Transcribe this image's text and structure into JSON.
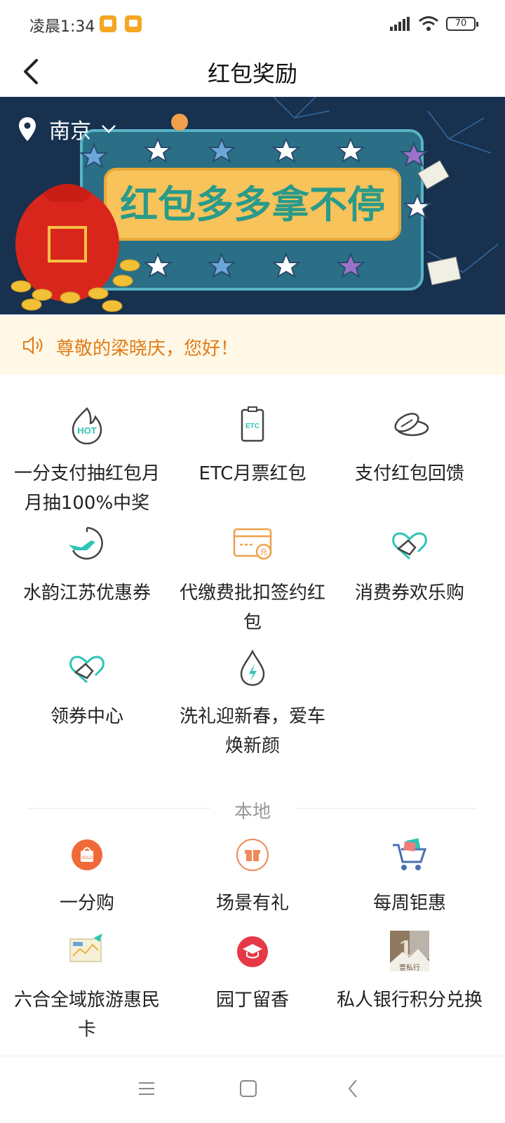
{
  "status": {
    "time": "凌晨1:34",
    "battery": "70"
  },
  "nav": {
    "title": "红包奖励"
  },
  "banner": {
    "location": "南京",
    "slogan": "红包多多拿不停"
  },
  "notice": {
    "text": "尊敬的梁晓庆，您好！"
  },
  "features": [
    {
      "label": "一分支付抽红包月月抽100%中奖",
      "icon": "hot-flame-icon"
    },
    {
      "label": "ETC月票红包",
      "icon": "etc-card-icon"
    },
    {
      "label": "支付红包回馈",
      "icon": "coins-icon"
    },
    {
      "label": "水韵江苏优惠券",
      "icon": "plane-clock-icon"
    },
    {
      "label": "代缴费批扣签约红包",
      "icon": "recharge-card-icon"
    },
    {
      "label": "消费券欢乐购",
      "icon": "handshake-icon"
    },
    {
      "label": "领券中心",
      "icon": "handshake-icon"
    },
    {
      "label": "洗礼迎新春，爱车焕新颜",
      "icon": "water-drop-icon"
    }
  ],
  "local": {
    "section_title": "本地",
    "items": [
      {
        "label": "一分购",
        "icon": "sold-bag-icon"
      },
      {
        "label": "场景有礼",
        "icon": "gift-icon"
      },
      {
        "label": "每周钜惠",
        "icon": "shopping-cart-icon"
      },
      {
        "label": "六合全域旅游惠民卡",
        "icon": "travel-card-icon"
      },
      {
        "label": "园丁留香",
        "icon": "graduation-cap-icon"
      },
      {
        "label": "私人银行积分兑换",
        "icon": "private-bank-logo"
      }
    ],
    "logo_text": "壹私行"
  },
  "colors": {
    "accent": "#e07b18",
    "teal": "#2ec4b6",
    "notice_bg": "#fff8e6"
  }
}
